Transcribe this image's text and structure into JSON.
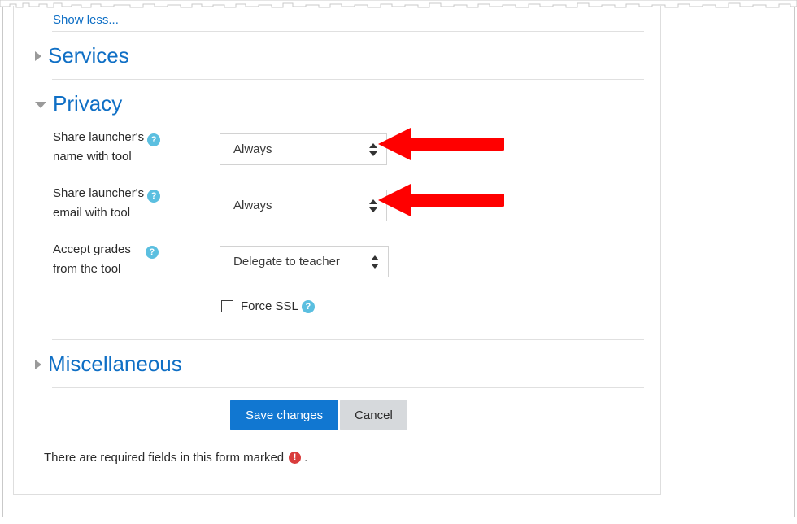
{
  "page": {
    "show_less_label": "Show less..."
  },
  "sections": [
    {
      "id": "services",
      "title": "Services",
      "expanded": false,
      "toggle_icon": "triangle-right-icon"
    },
    {
      "id": "privacy",
      "title": "Privacy",
      "expanded": true,
      "toggle_icon": "triangle-down-icon"
    },
    {
      "id": "miscellaneous",
      "title": "Miscellaneous",
      "expanded": false,
      "toggle_icon": "triangle-right-icon"
    }
  ],
  "privacy_fields": [
    {
      "id": "share-launcher-name",
      "label_line1": "Share launcher's",
      "label_line2": "name with tool",
      "help_icon": "help-circle-icon",
      "help_glyph": "?",
      "value": "Always",
      "annotated": true
    },
    {
      "id": "share-launcher-email",
      "label_line1": "Share launcher's",
      "label_line2": "email with tool",
      "help_icon": "help-circle-icon",
      "help_glyph": "?",
      "value": "Always",
      "annotated": true
    },
    {
      "id": "accept-grades",
      "label_line1": "Accept grades",
      "label_line2": "from the tool",
      "help_icon": "help-circle-icon",
      "help_glyph": "?",
      "value": "Delegate to teacher",
      "annotated": false
    }
  ],
  "force_ssl": {
    "label": "Force SSL",
    "checked": false,
    "help_icon": "help-circle-icon",
    "help_glyph": "?"
  },
  "buttons": {
    "save_label": "Save changes",
    "cancel_label": "Cancel"
  },
  "footer": {
    "required_text_before": "There are required fields in this form marked",
    "required_icon": "exclamation-circle-icon",
    "required_glyph": "!",
    "required_text_after": "."
  },
  "annotations": {
    "arrow_color": "#FF0000",
    "arrow_direction": "left",
    "count": 2
  },
  "colors": {
    "link_blue": "#0f6fc5",
    "heading_blue": "#0f6fc5",
    "primary_button": "#1177d1",
    "secondary_button": "#d6d9dc",
    "help_icon": "#5bbfe0",
    "required_icon": "#d93c3c",
    "divider": "#e0e0e0",
    "arrow_red": "#FF0000"
  }
}
